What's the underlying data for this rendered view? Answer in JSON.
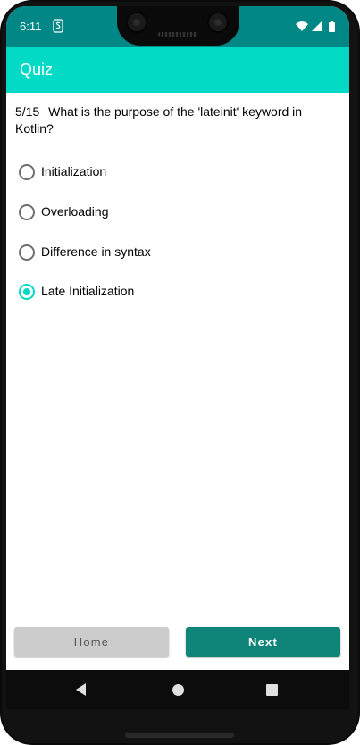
{
  "status_bar": {
    "time": "6:11",
    "left_icon": "sim-s-icon",
    "right_icons": [
      "wifi-icon",
      "signal-icon",
      "battery-icon"
    ]
  },
  "app_bar": {
    "title": "Quiz"
  },
  "question": {
    "progress": "5/15",
    "text": "What is the purpose of the 'lateinit' keyword in Kotlin?"
  },
  "options": [
    {
      "label": "Initialization",
      "selected": false
    },
    {
      "label": "Overloading",
      "selected": false
    },
    {
      "label": "Difference in syntax",
      "selected": false
    },
    {
      "label": "Late Initialization",
      "selected": true
    }
  ],
  "buttons": {
    "home": "Home",
    "next": "Next"
  },
  "colors": {
    "status_bar": "#018786",
    "app_bar": "#03dac5",
    "accent": "#03dac5",
    "next_button": "#0f857a",
    "home_button": "#cccccc"
  },
  "nav_bar": {
    "icons": [
      "back-icon",
      "home-icon",
      "recents-icon"
    ]
  }
}
